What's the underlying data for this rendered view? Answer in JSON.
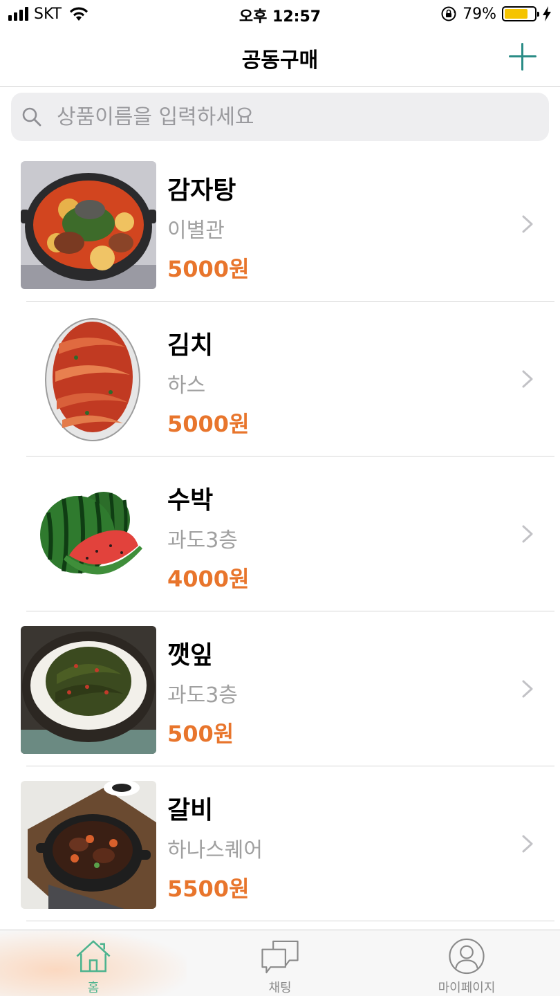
{
  "status_bar": {
    "carrier": "SKT",
    "time": "오후 12:57",
    "battery": "79%",
    "battery_level": 0.79,
    "signal_bars": 4,
    "signal_total": 4
  },
  "nav": {
    "title": "공동구매",
    "add_icon": "plus-icon",
    "accent_color": "#2a8c86"
  },
  "search": {
    "placeholder": "상품이름을 입력하세요",
    "value": ""
  },
  "products": [
    {
      "name": "감자탕",
      "store": "이별관",
      "price": "5000원",
      "image": "gamjatang-photo"
    },
    {
      "name": "김치",
      "store": "하스",
      "price": "5000원",
      "image": "kimchi-photo"
    },
    {
      "name": "수박",
      "store": "과도3층",
      "price": "4000원",
      "image": "watermelon-photo"
    },
    {
      "name": "깻잎",
      "store": "과도3층",
      "price": "500원",
      "image": "perilla-leaves-photo"
    },
    {
      "name": "갈비",
      "store": "하나스퀘어",
      "price": "5500원",
      "image": "galbi-photo"
    }
  ],
  "colors": {
    "price": "#e8752c",
    "active_tab": "#4cb38e",
    "inactive_tab": "#8a8a8a"
  },
  "tabs": [
    {
      "label": "홈",
      "icon": "home-icon",
      "active": true
    },
    {
      "label": "채팅",
      "icon": "chat-icon",
      "active": false
    },
    {
      "label": "마이페이지",
      "icon": "profile-icon",
      "active": false
    }
  ]
}
